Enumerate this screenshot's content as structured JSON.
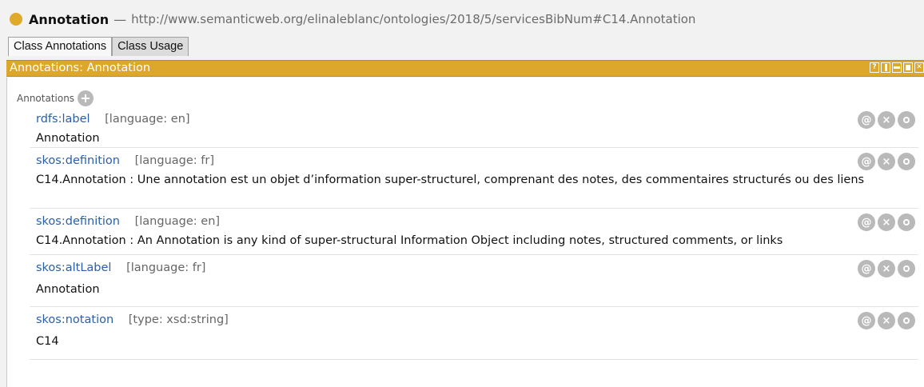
{
  "entity": {
    "name": "Annotation",
    "separator": "—",
    "iri": "http://www.semanticweb.org/elinaleblanc/ontologies/2018/5/servicesBibNum#C14.Annotation",
    "dot_color": "#e0a92a"
  },
  "tabs": [
    {
      "label": "Class Annotations",
      "active": true
    },
    {
      "label": "Class Usage",
      "active": false
    }
  ],
  "view": {
    "title": "Annotations: Annotation",
    "header_color": "#dca72b",
    "controls": {
      "help": "?",
      "icons": [
        "split-vertical-icon",
        "split-horizontal-icon",
        "maximize-icon",
        "close-icon"
      ]
    }
  },
  "annotations_header": {
    "label": "Annotations",
    "add_icon": "plus-circle-icon"
  },
  "annotations": [
    {
      "property": "rdfs:label",
      "qualifier": "[language: en]",
      "value": "Annotation"
    },
    {
      "property": "skos:definition",
      "qualifier": "[language: fr]",
      "value": "C14.Annotation : Une annotation est un objet d’information super-structurel, comprenant des notes, des commentaires structurés ou des liens"
    },
    {
      "property": "skos:definition",
      "qualifier": "[language: en]",
      "value": "C14.Annotation : An Annotation is any kind of super-structural Information Object including notes, structured comments, or links"
    },
    {
      "property": "skos:altLabel",
      "qualifier": "[language: fr]",
      "value": "Annotation"
    },
    {
      "property": "skos:notation",
      "qualifier": "[type: xsd:string]",
      "value": "C14"
    }
  ],
  "row_actions": {
    "annotate": "@",
    "delete": "×",
    "edit_icon": "edit-circle-icon"
  }
}
